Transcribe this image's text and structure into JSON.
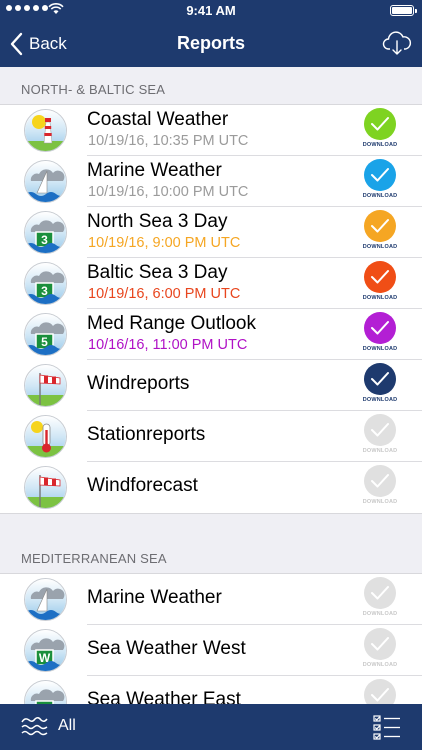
{
  "status": {
    "time": "9:41 AM"
  },
  "nav": {
    "back_label": "Back",
    "title": "Reports",
    "cloud_icon": "cloud-download-icon"
  },
  "sections": [
    {
      "header": "NORTH- & BALTIC SEA",
      "items": [
        {
          "title": "Coastal Weather",
          "date": "10/19/16, 10:35 PM UTC",
          "date_color": "#9b9b9b",
          "icon": "lighthouse",
          "download_color": "#7ed321",
          "download_label": "DOWNLOAD",
          "active": true
        },
        {
          "title": "Marine Weather",
          "date": "10/19/16, 10:00 PM UTC",
          "date_color": "#9b9b9b",
          "icon": "sailboat",
          "download_color": "#1aa3e8",
          "download_label": "DOWNLOAD",
          "active": true
        },
        {
          "title": "North Sea 3 Day",
          "date": "10/19/16, 9:00 PM UTC",
          "date_color": "#f5a623",
          "icon": "badge-3",
          "badge": "3",
          "download_color": "#f5a623",
          "download_label": "DOWNLOAD",
          "active": true
        },
        {
          "title": "Baltic Sea 3 Day",
          "date": "10/19/16, 6:00 PM UTC",
          "date_color": "#e8461e",
          "icon": "badge-3",
          "badge": "3",
          "download_color": "#f04e16",
          "download_label": "DOWNLOAD",
          "active": true
        },
        {
          "title": "Med Range Outlook",
          "date": "10/16/16, 11:00 PM UTC",
          "date_color": "#b012c6",
          "icon": "badge-5",
          "badge": "5",
          "download_color": "#b31fd4",
          "download_label": "DOWNLOAD",
          "active": true
        },
        {
          "title": "Windreports",
          "date": "",
          "date_color": "",
          "icon": "windsock",
          "download_color": "#1e3a6e",
          "download_label": "DOWNLOAD",
          "active": true
        },
        {
          "title": "Stationreports",
          "date": "",
          "date_color": "",
          "icon": "thermometer",
          "download_color": "#e0e0e0",
          "download_label": "DOWNLOAD",
          "active": false
        },
        {
          "title": "Windforecast",
          "date": "",
          "date_color": "",
          "icon": "windsock",
          "download_color": "#e0e0e0",
          "download_label": "DOWNLOAD",
          "active": false
        }
      ]
    },
    {
      "header": "MEDITERRANEAN SEA",
      "items": [
        {
          "title": "Marine Weather",
          "date": "",
          "date_color": "",
          "icon": "sailboat",
          "download_color": "#e0e0e0",
          "download_label": "DOWNLOAD",
          "active": false
        },
        {
          "title": "Sea Weather West",
          "date": "",
          "date_color": "",
          "icon": "badge-w",
          "badge": "W",
          "download_color": "#e0e0e0",
          "download_label": "DOWNLOAD",
          "active": false
        },
        {
          "title": "Sea Weather East",
          "date": "",
          "date_color": "",
          "icon": "badge-e",
          "badge": "E",
          "download_color": "#e0e0e0",
          "download_label": "DOWNLOAD",
          "active": false
        }
      ]
    }
  ],
  "tabbar": {
    "all_label": "All",
    "all_icon": "waves-icon",
    "list_icon": "checklist-icon"
  }
}
